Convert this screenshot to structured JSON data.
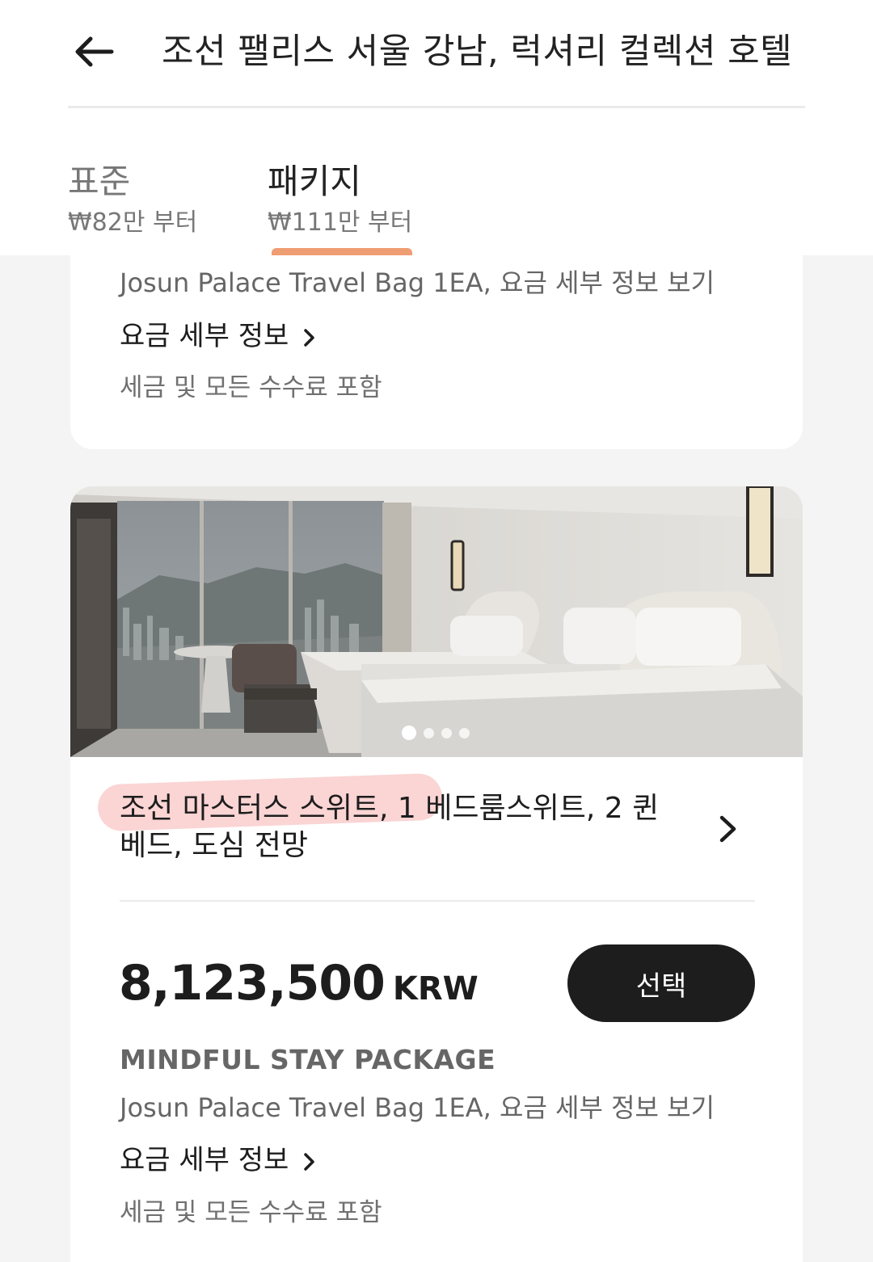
{
  "header": {
    "title": "조선 팰리스 서울 강남, 럭셔리 컬렉션 호텔",
    "back_icon": "arrow-left-icon"
  },
  "tabs": [
    {
      "label": "표준",
      "price": "₩82만 부터",
      "active": false
    },
    {
      "label": "패키지",
      "price": "₩111만 부터",
      "active": true
    }
  ],
  "colors": {
    "accent": "#ef9d73",
    "button": "#1d1d1d",
    "highlight": "#f7b1b1"
  },
  "previous_offer": {
    "inclusion": "Josun Palace Travel Bag 1EA, 요금 세부 정보 보기",
    "details_link": "요금 세부 정보",
    "tax_note": "세금 및 모든 수수료 포함"
  },
  "room": {
    "photo_dots": 4,
    "active_dot": 1,
    "title": "조선 마스터스 스위트, 1 베드룸스위트, 2 퀸베드, 도심 전망",
    "price_amount": "8,123,500",
    "price_currency": "KRW",
    "select_label": "선택",
    "package_name": "MINDFUL STAY PACKAGE",
    "inclusion": "Josun Palace Travel Bag 1EA, 요금 세부 정보 보기",
    "details_link": "요금 세부 정보",
    "tax_note": "세금 및 모든 수수료 포함"
  }
}
